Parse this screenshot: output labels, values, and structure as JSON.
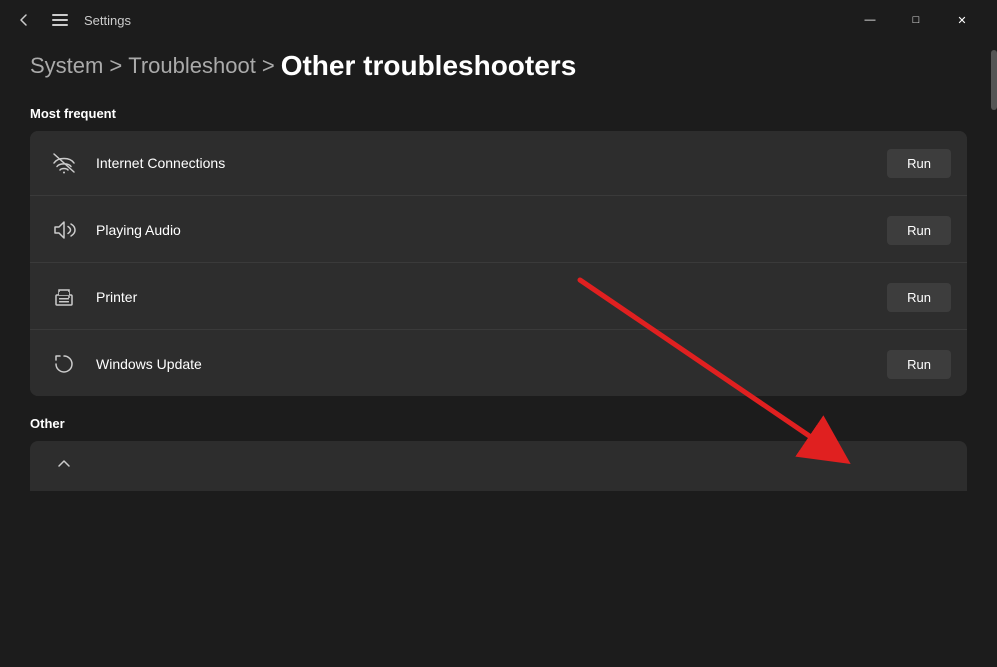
{
  "window": {
    "title": "Settings",
    "controls": {
      "minimize": "—",
      "maximize": "□",
      "close": "✕"
    }
  },
  "breadcrumb": {
    "system": "System",
    "separator1": ">",
    "troubleshoot": "Troubleshoot",
    "separator2": ">",
    "current": "Other troubleshooters"
  },
  "sections": {
    "most_frequent": {
      "label": "Most frequent",
      "items": [
        {
          "id": "internet-connections",
          "label": "Internet Connections",
          "button": "Run"
        },
        {
          "id": "playing-audio",
          "label": "Playing Audio",
          "button": "Run"
        },
        {
          "id": "printer",
          "label": "Printer",
          "button": "Run"
        },
        {
          "id": "windows-update",
          "label": "Windows Update",
          "button": "Run"
        }
      ]
    },
    "other": {
      "label": "Other"
    }
  }
}
